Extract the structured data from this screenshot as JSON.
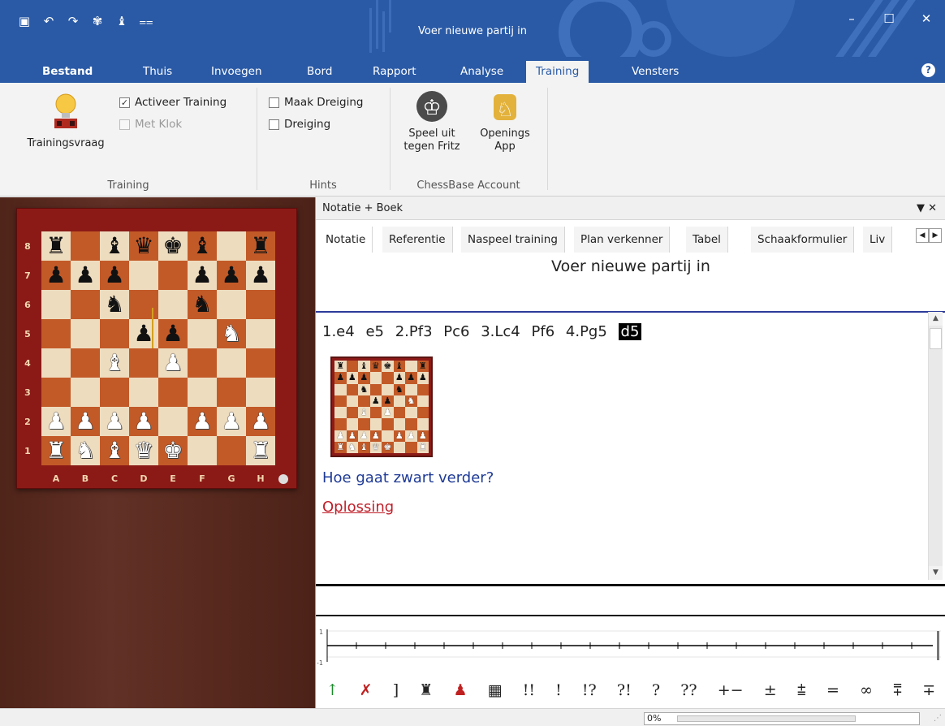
{
  "window": {
    "title": "Voer nieuwe partij in"
  },
  "menu_tabs": [
    "Bestand",
    "Thuis",
    "Invoegen",
    "Bord",
    "Rapport",
    "Analyse",
    "Training",
    "Vensters"
  ],
  "ribbon": {
    "training": {
      "button": "Trainingsvraag",
      "chk1": "Activeer Training",
      "chk2": "Met Klok",
      "label": "Training"
    },
    "hints": {
      "chk1": "Maak Dreiging",
      "chk2": "Dreiging",
      "label": "Hints"
    },
    "account": {
      "btn1a": "Speel uit",
      "btn1b": "tegen Fritz",
      "btn2a": "Openings",
      "btn2b": "App",
      "label": "ChessBase Account"
    }
  },
  "panel": {
    "title": "Notatie + Boek",
    "tabs": [
      "Notatie",
      "Referentie",
      "Naspeel training",
      "Plan verkenner",
      "Tabel",
      "Schaakformulier",
      "Liv"
    ],
    "heading": "Voer nieuwe partij in",
    "moves": [
      "1.e4",
      "e5",
      "2.Pf3",
      "Pc6",
      "3.Lc4",
      "Pf6",
      "4.Pg5"
    ],
    "current_move": "d5",
    "question": "Hoe gaat zwart verder?",
    "solution": "Oplossing"
  },
  "board": {
    "ranks": [
      "8",
      "7",
      "6",
      "5",
      "4",
      "3",
      "2",
      "1"
    ],
    "files": [
      "A",
      "B",
      "C",
      "D",
      "E",
      "F",
      "G",
      "H"
    ],
    "position": [
      "r.bqkb.r",
      "ppp..ppp",
      "..n..n..",
      "...pp.N.",
      "..B.P...",
      "........",
      "PPPP.PPP",
      "RNBQK..R"
    ]
  },
  "graph": {
    "ticks": [
      "2",
      "4",
      "6",
      "8",
      "10",
      "12",
      "14",
      "16",
      "18"
    ],
    "ymax": "1",
    "ymin": "-1"
  },
  "annotations": [
    "!!",
    "!",
    "!?",
    "?!",
    "?",
    "??",
    "+−",
    "±",
    "⩲",
    "=",
    "∞",
    "⩱",
    "∓"
  ],
  "status": {
    "progress": "0%"
  }
}
